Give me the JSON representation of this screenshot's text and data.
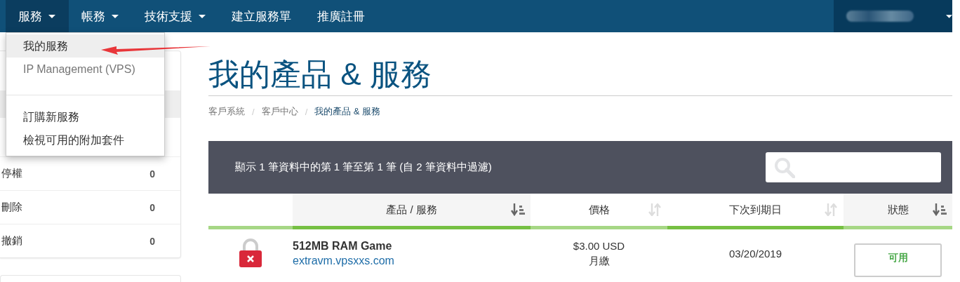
{
  "nav": {
    "items": [
      {
        "label": "服務",
        "dropdown": true,
        "selected": true
      },
      {
        "label": "帳務",
        "dropdown": true,
        "selected": false
      },
      {
        "label": "技術支援",
        "dropdown": true,
        "selected": false
      },
      {
        "label": "建立服務單",
        "dropdown": false,
        "selected": false
      },
      {
        "label": "推廣註冊",
        "dropdown": false,
        "selected": false
      }
    ],
    "user_menu": {
      "dropdown": true
    }
  },
  "dropdown_menu": {
    "items": [
      {
        "kind": "item",
        "label": "我的服務",
        "selected": true,
        "dimmed": false
      },
      {
        "kind": "item",
        "label": "IP Management (VPS)",
        "selected": false,
        "dimmed": true
      },
      {
        "kind": "divider"
      },
      {
        "kind": "item",
        "label": "訂購新服務",
        "selected": false,
        "dimmed": false
      },
      {
        "kind": "item",
        "label": "檢視可用的附加套件",
        "selected": false,
        "dimmed": false
      }
    ]
  },
  "sidebar": {
    "rows": [
      {
        "label": "停權",
        "count": "0"
      },
      {
        "label": "刪除",
        "count": "0"
      },
      {
        "label": "撤銷",
        "count": "0"
      }
    ]
  },
  "page": {
    "title": "我的產品 & 服務",
    "breadcrumb_separator": "/",
    "breadcrumb": [
      {
        "label": "客戶系統",
        "active": false
      },
      {
        "label": "客戶中心",
        "active": false
      },
      {
        "label": "我的產品 & 服務",
        "active": true
      }
    ]
  },
  "table": {
    "info": "顯示 1 筆資料中的第 1 筆至第 1 筆 (自 2 筆資料中過濾)",
    "columns": [
      {
        "accent": false
      },
      {
        "label": "產品 / 服務",
        "sorted": true,
        "accent": true
      },
      {
        "label": "價格",
        "sorted": false,
        "accent": false
      },
      {
        "label": "下次到期日",
        "sorted": false,
        "accent": true
      },
      {
        "label": "狀態",
        "sorted": true,
        "accent": false
      }
    ],
    "rows": [
      {
        "kind": "locked",
        "name": "512MB RAM Game",
        "domain": "extravm.vpsxxs.com",
        "price": "$3.00 USD",
        "cycle": "月繳",
        "due": "03/20/2019",
        "status": "可用"
      }
    ]
  }
}
